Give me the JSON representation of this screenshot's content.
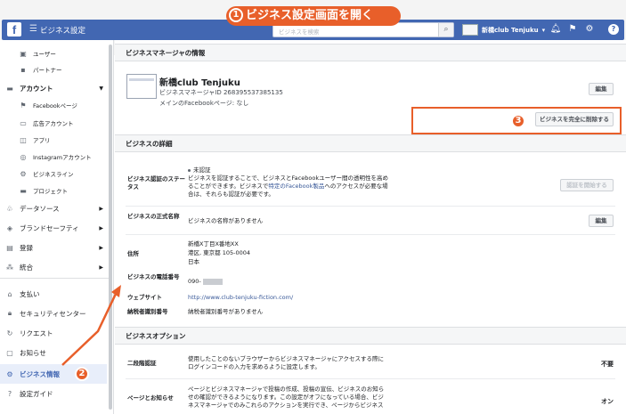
{
  "topbar": {
    "title": "ビジネス設定",
    "search_placeholder": "ビジネスを検索",
    "account_name": "新橋club Tenjuku",
    "annotation": "ビジネス設定画面を開く",
    "annotation_num": "1"
  },
  "sidebar": {
    "items": [
      {
        "label": "ユーザー",
        "icon": "user-icon"
      },
      {
        "label": "パートナー",
        "icon": "partner-icon"
      },
      {
        "label": "アカウント",
        "icon": "folder-icon"
      },
      {
        "label": "Facebookページ",
        "icon": "flag-icon"
      },
      {
        "label": "広告アカウント",
        "icon": "ad-account-icon"
      },
      {
        "label": "アプリ",
        "icon": "app-icon"
      },
      {
        "label": "Instagramアカウント",
        "icon": "instagram-icon"
      },
      {
        "label": "ビジネスライン",
        "icon": "business-line-icon"
      },
      {
        "label": "プロジェクト",
        "icon": "project-icon"
      },
      {
        "label": "データソース",
        "icon": "data-source-icon"
      },
      {
        "label": "ブランドセーフティ",
        "icon": "shield-icon"
      },
      {
        "label": "登録",
        "icon": "register-icon"
      },
      {
        "label": "統合",
        "icon": "integration-icon"
      },
      {
        "label": "支払い",
        "icon": "payment-icon"
      },
      {
        "label": "セキュリティセンター",
        "icon": "lock-icon"
      },
      {
        "label": "リクエスト",
        "icon": "request-icon"
      },
      {
        "label": "お知らせ",
        "icon": "notification-icon"
      },
      {
        "label": "ビジネス情報",
        "icon": "gear-icon"
      },
      {
        "label": "設定ガイド",
        "icon": "help-icon"
      }
    ],
    "annotation_num": "2"
  },
  "main": {
    "manager_header": "ビジネスマネージャの情報",
    "biz_name": "新橋club Tenjuku",
    "biz_id": "ビジネスマネージャID 268395537385135",
    "main_page": "メインのFacebookページ: なし",
    "edit_label": "編集",
    "delete_label": "ビジネスを完全に削除する",
    "annotation_num": "3",
    "details_header": "ビジネスの詳細",
    "verification_label": "ビジネス認証のステータス",
    "verification_status": "未認証",
    "verification_desc_1": "ビジネスを認証することで、ビジネスとFacebookユーザー間の透明性を高め",
    "verification_desc_2": "ることができます。ビジネスで",
    "verification_link": "特定のFacebook製品",
    "verification_desc_3": "へのアクセスが必要な場",
    "verification_desc_4": "合は、それらも認証が必要です。",
    "start_verify_label": "認証を開始する",
    "legal_name_label": "ビジネスの正式名称",
    "legal_name_val": "ビジネスの名称がありません",
    "edit2_label": "編集",
    "address_label": "住所",
    "address_1": "新橋X丁目X番地XX",
    "address_2": "港区, 東京都 105-0004",
    "address_3": "日本",
    "phone_label": "ビジネスの電話番号",
    "phone_val": "090-",
    "website_label": "ウェブサイト",
    "website_val": "http://www.club-tenjuku-fiction.com/",
    "tax_label": "納税者識別番号",
    "tax_val": "納税者識別番号がありません",
    "options_header": "ビジネスオプション",
    "twofa_label": "二段階認証",
    "twofa_desc_1": "使用したことのないブラウザーからビジネスマネージャにアクセスする際に",
    "twofa_desc_2": "ログインコードの入力を求めるように設定します。",
    "twofa_val": "不要",
    "notice_label": "ページとお知らせ",
    "notice_desc_1": "ページとビジネスマネージャで投稿の作成、投稿の宣伝、ビジネスのお知ら",
    "notice_desc_2": "せの確認ができるようになります。この設定がオフになっている場合、ビジ",
    "notice_desc_3": "ネスマネージャでのみこれらのアクションを実行でき、ページからビジネス",
    "notice_val": "オン"
  },
  "colors": {
    "accent": "#4267b2",
    "annotation": "#e85f2a"
  }
}
